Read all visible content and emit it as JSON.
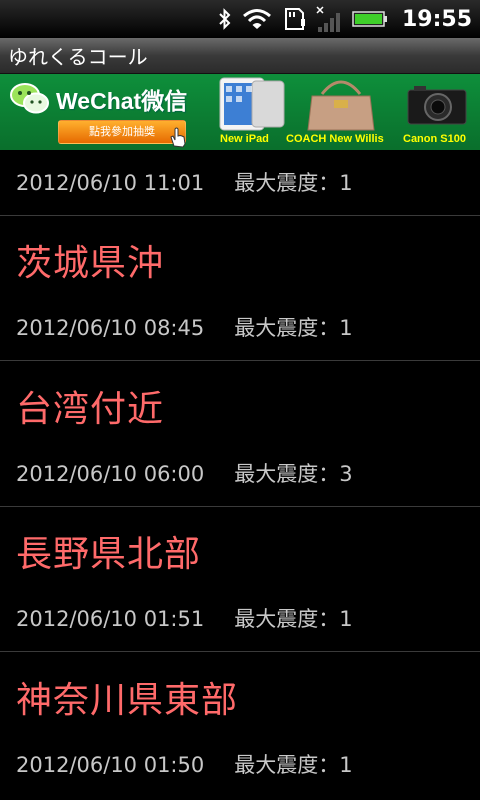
{
  "status_bar": {
    "time": "19:55",
    "icons": [
      "bluetooth-icon",
      "wifi-icon",
      "sd-card-icon",
      "signal-icon",
      "battery-icon"
    ]
  },
  "app": {
    "title": "ゆれくるコール"
  },
  "ad": {
    "logo_text": "WeChat微信",
    "cta": "點我參加抽獎",
    "products": [
      "New iPad",
      "COACH New Willis",
      "Canon S100"
    ],
    "colors": {
      "background": "#0e8f3b",
      "cta": "#f08a10",
      "product_label": "#ffff00"
    }
  },
  "earthquakes": [
    {
      "place": "",
      "datetime": "2012/06/10 11:01",
      "intensity_label": "最大震度：",
      "intensity": "1"
    },
    {
      "place": "茨城県沖",
      "datetime": "2012/06/10 08:45",
      "intensity_label": "最大震度：",
      "intensity": "1"
    },
    {
      "place": "台湾付近",
      "datetime": "2012/06/10 06:00",
      "intensity_label": "最大震度：",
      "intensity": "3"
    },
    {
      "place": "長野県北部",
      "datetime": "2012/06/10 01:51",
      "intensity_label": "最大震度：",
      "intensity": "1"
    },
    {
      "place": "神奈川県東部",
      "datetime": "2012/06/10 01:50",
      "intensity_label": "最大震度：",
      "intensity": "1"
    }
  ],
  "colors": {
    "place_text": "#ff6a6a",
    "meta_text": "#c8c8c8",
    "background": "#000000"
  }
}
